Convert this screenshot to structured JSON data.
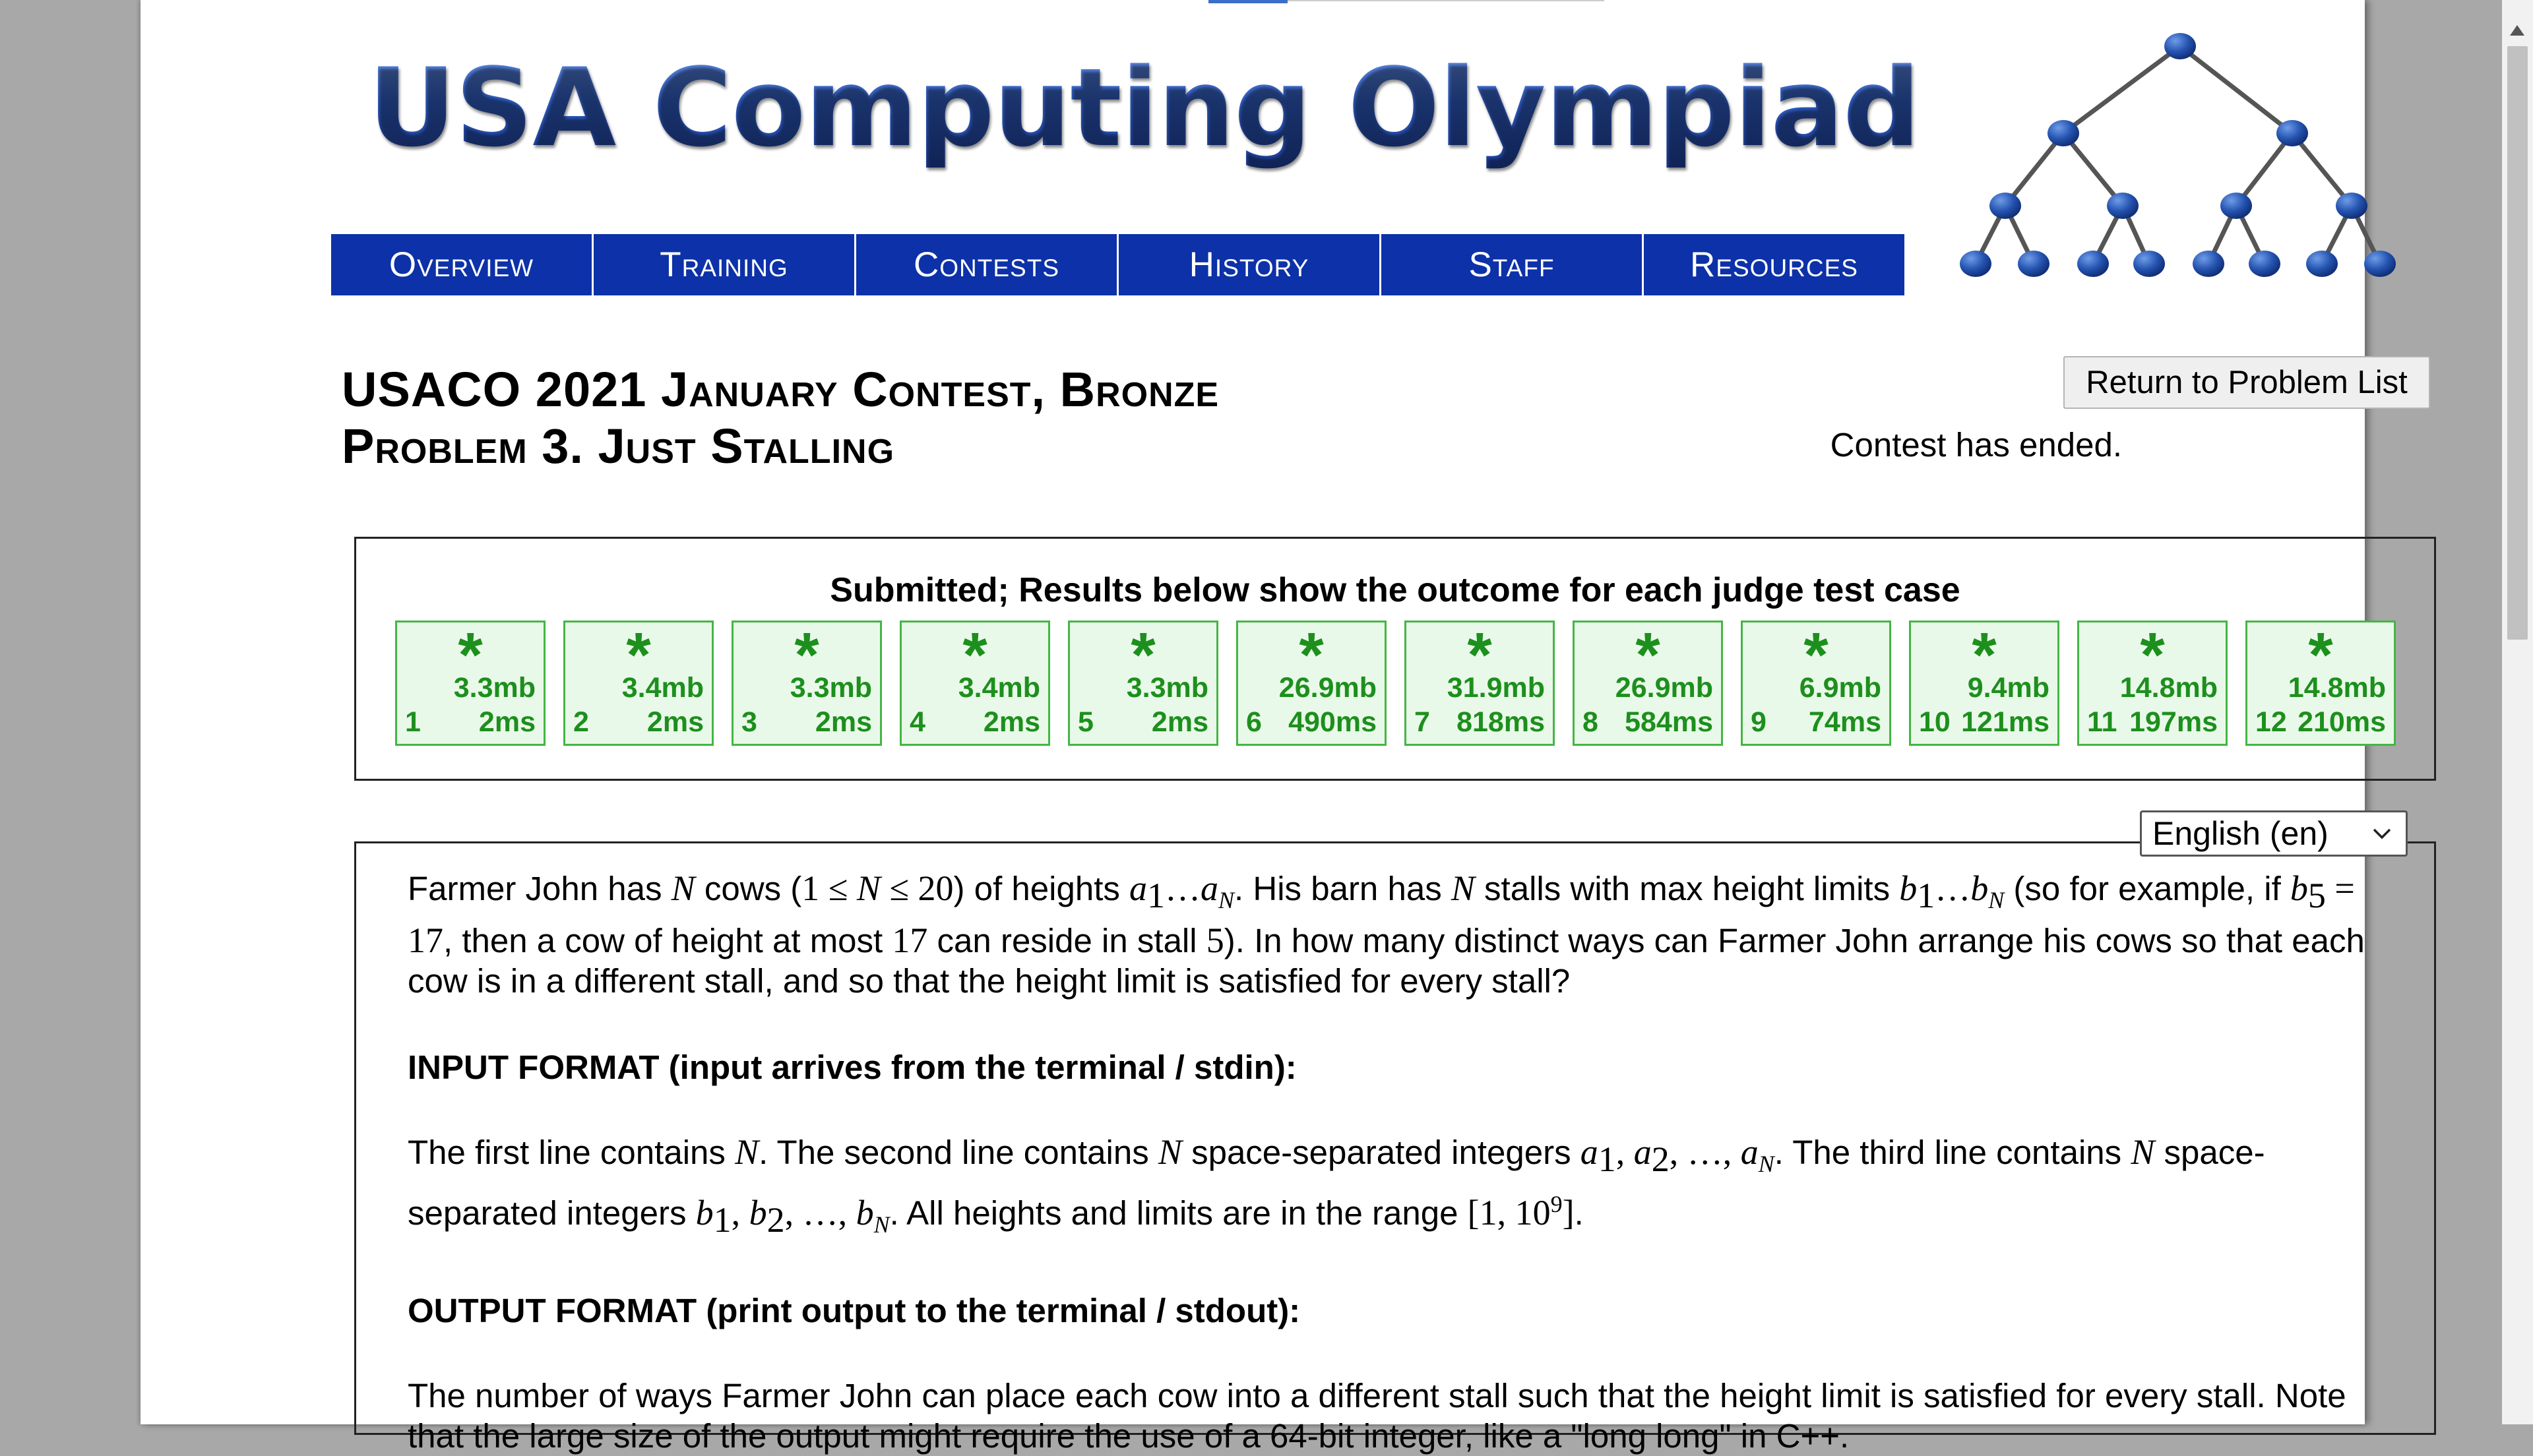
{
  "site": {
    "logo_text": "USA Computing Olympiad"
  },
  "nav": [
    {
      "label": "Overview"
    },
    {
      "label": "Training"
    },
    {
      "label": "Contests"
    },
    {
      "label": "History"
    },
    {
      "label": "Staff"
    },
    {
      "label": "Resources"
    }
  ],
  "header": {
    "title_line1": "USACO 2021 January Contest, Bronze",
    "title_line2": "Problem 3. Just Stalling",
    "return_button": "Return to Problem List",
    "status": "Contest has ended."
  },
  "results": {
    "heading": "Submitted; Results below show the outcome for each judge test case",
    "cases": [
      {
        "num": "1",
        "symbol": "*",
        "memory": "3.3mb",
        "time": "2ms"
      },
      {
        "num": "2",
        "symbol": "*",
        "memory": "3.4mb",
        "time": "2ms"
      },
      {
        "num": "3",
        "symbol": "*",
        "memory": "3.3mb",
        "time": "2ms"
      },
      {
        "num": "4",
        "symbol": "*",
        "memory": "3.4mb",
        "time": "2ms"
      },
      {
        "num": "5",
        "symbol": "*",
        "memory": "3.3mb",
        "time": "2ms"
      },
      {
        "num": "6",
        "symbol": "*",
        "memory": "26.9mb",
        "time": "490ms"
      },
      {
        "num": "7",
        "symbol": "*",
        "memory": "31.9mb",
        "time": "818ms"
      },
      {
        "num": "8",
        "symbol": "*",
        "memory": "26.9mb",
        "time": "584ms"
      },
      {
        "num": "9",
        "symbol": "*",
        "memory": "6.9mb",
        "time": "74ms"
      },
      {
        "num": "10",
        "symbol": "*",
        "memory": "9.4mb",
        "time": "121ms"
      },
      {
        "num": "11",
        "symbol": "*",
        "memory": "14.8mb",
        "time": "197ms"
      },
      {
        "num": "12",
        "symbol": "*",
        "memory": "14.8mb",
        "time": "210ms"
      }
    ],
    "pass_color": "#1d8f1d"
  },
  "language": {
    "selected": "English (en)"
  },
  "problem": {
    "input_heading": "INPUT FORMAT (input arrives from the terminal / stdin):",
    "output_heading": "OUTPUT FORMAT (print output to the terminal / stdout):",
    "output_body": "The number of ways Farmer John can place each cow into a different stall such that the height limit is satisfied for every stall. Note that the large size of the output might require the use of a 64-bit integer, like a \"long long\" in C++."
  },
  "colors": {
    "nav_bg": "#0d31a8",
    "logo_blue": "#2a56b8"
  }
}
